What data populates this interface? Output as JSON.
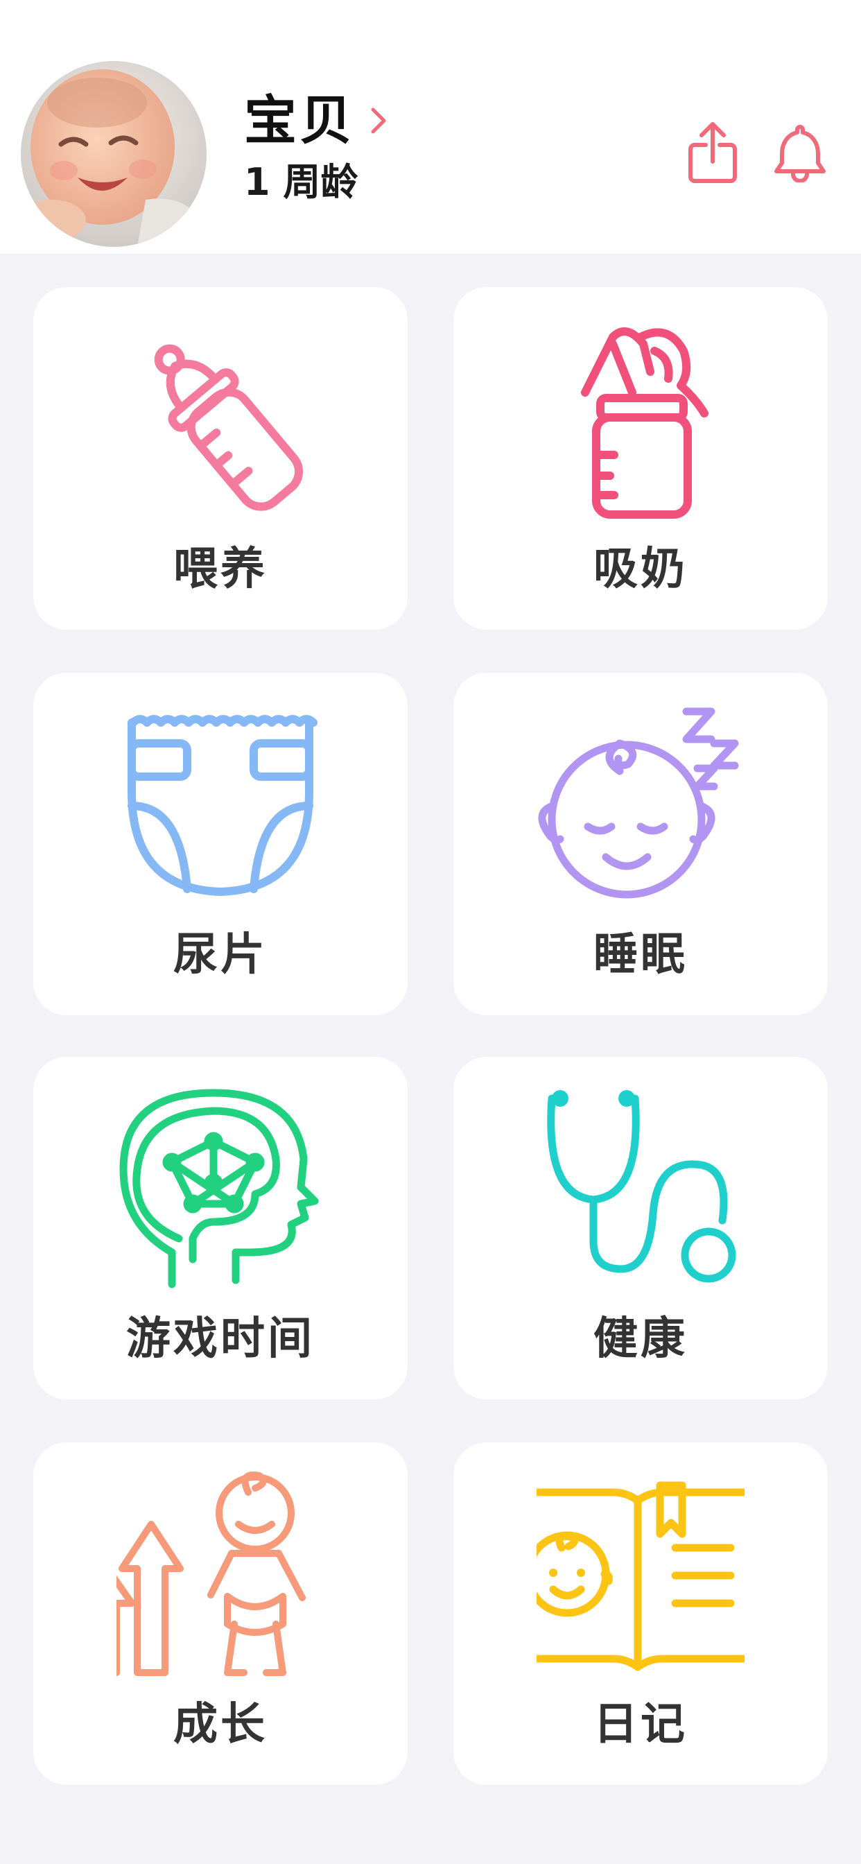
{
  "baby": {
    "name": "宝贝",
    "age": "1 周龄"
  },
  "header": {
    "share_icon": "share-icon",
    "bell_icon": "bell-icon",
    "accent": "#f06a7a"
  },
  "tiles": [
    {
      "label": "喂养",
      "icon": "baby-bottle-icon",
      "color": "#f47a9e"
    },
    {
      "label": "吸奶",
      "icon": "breast-pump-icon",
      "color": "#f0507a"
    },
    {
      "label": "尿片",
      "icon": "diaper-icon",
      "color": "#86b8f6"
    },
    {
      "label": "睡眠",
      "icon": "sleeping-baby-icon",
      "color": "#b294f2"
    },
    {
      "label": "游戏时间",
      "icon": "brain-head-icon",
      "color": "#22d17f"
    },
    {
      "label": "健康",
      "icon": "stethoscope-icon",
      "color": "#1fcfcc"
    },
    {
      "label": "成长",
      "icon": "growth-baby-icon",
      "color": "#f69a7a"
    },
    {
      "label": "日记",
      "icon": "diary-book-icon",
      "color": "#fdc414"
    }
  ]
}
